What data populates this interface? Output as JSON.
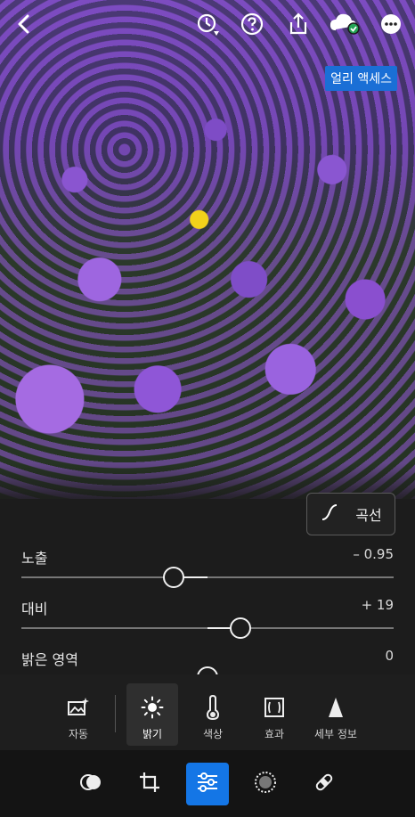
{
  "header": {
    "icons": [
      "back-icon",
      "history-icon",
      "help-icon",
      "share-icon",
      "cloud-sync-icon",
      "more-icon"
    ],
    "cloud_tooltip": "얼리 액세스"
  },
  "curve_button": {
    "label": "곡선",
    "icon": "curve-icon"
  },
  "sliders": [
    {
      "label": "노출",
      "value_text": "– 0.95",
      "value": -0.95,
      "range": [
        -5,
        5
      ]
    },
    {
      "label": "대비",
      "value_text": "+ 19",
      "value": 19,
      "range": [
        -100,
        100
      ]
    },
    {
      "label": "밝은 영역",
      "value_text": "0",
      "value": 0,
      "range": [
        -100,
        100
      ]
    }
  ],
  "tools": [
    {
      "label": "자동",
      "icon": "auto-icon"
    },
    {
      "label": "밝기",
      "icon": "brightness-icon",
      "active": true
    },
    {
      "label": "색상",
      "icon": "thermometer-icon"
    },
    {
      "label": "효과",
      "icon": "effects-icon"
    },
    {
      "label": "세부 정보",
      "icon": "detail-icon"
    }
  ],
  "bottom_bar": [
    "presets-icon",
    "crop-icon",
    "adjust-icon",
    "masking-icon",
    "healing-icon"
  ],
  "colors": {
    "accent": "#1476e6",
    "panel": "#1c1c1c"
  }
}
